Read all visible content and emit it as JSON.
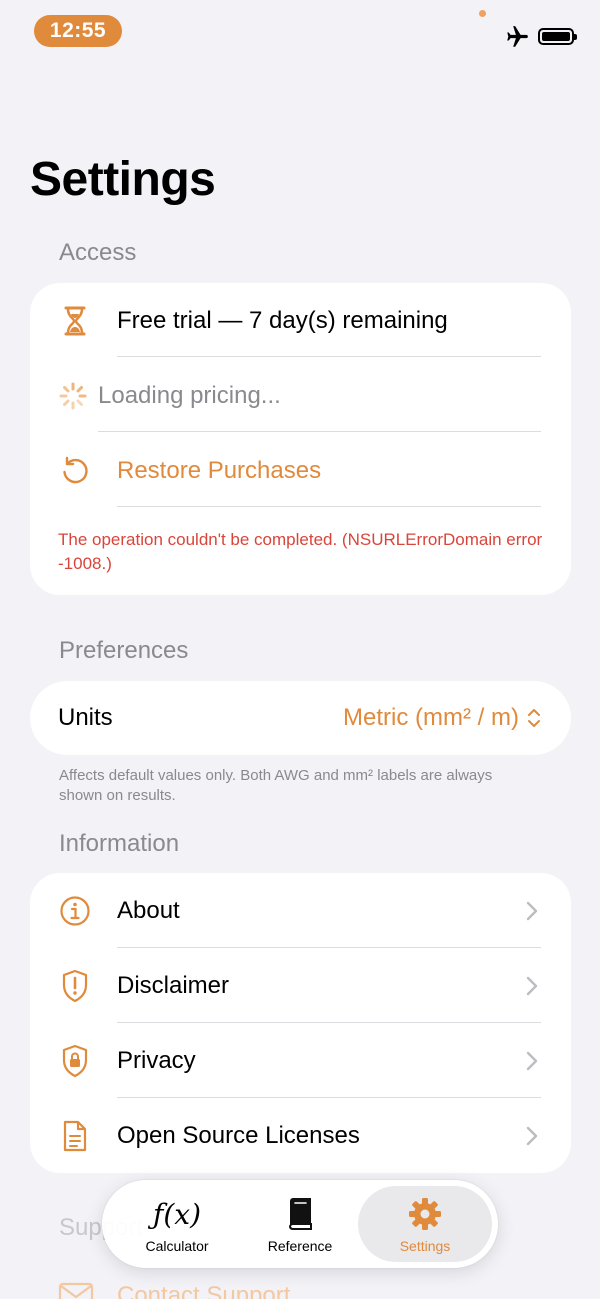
{
  "status_bar": {
    "time": "12:55"
  },
  "page": {
    "title": "Settings"
  },
  "sections": {
    "access": {
      "header": "Access",
      "trial_label": "Free trial — 7 day(s) remaining",
      "loading_label": "Loading pricing...",
      "restore_label": "Restore Purchases",
      "error": "The operation couldn't be completed. (NSURLErrorDomain error -1008.)"
    },
    "preferences": {
      "header": "Preferences",
      "units_label": "Units",
      "units_value": "Metric (mm² / m)",
      "footnote": "Affects default values only. Both AWG and mm² labels are always shown on results."
    },
    "information": {
      "header": "Information",
      "items": [
        {
          "label": "About",
          "icon": "info-circle-icon"
        },
        {
          "label": "Disclaimer",
          "icon": "shield-exclamation-icon"
        },
        {
          "label": "Privacy",
          "icon": "shield-lock-icon"
        },
        {
          "label": "Open Source Licenses",
          "icon": "document-icon"
        }
      ]
    },
    "support": {
      "header": "Support",
      "contact_label": "Contact Support"
    }
  },
  "tab_bar": {
    "tabs": [
      {
        "label": "Calculator",
        "icon_text": "ƒ(x)"
      },
      {
        "label": "Reference"
      },
      {
        "label": "Settings"
      }
    ],
    "active": "Settings"
  },
  "colors": {
    "accent": "#e08a3c",
    "error": "#d9453a",
    "secondary_text": "#8a8a8e",
    "background": "#f2f2f7"
  }
}
